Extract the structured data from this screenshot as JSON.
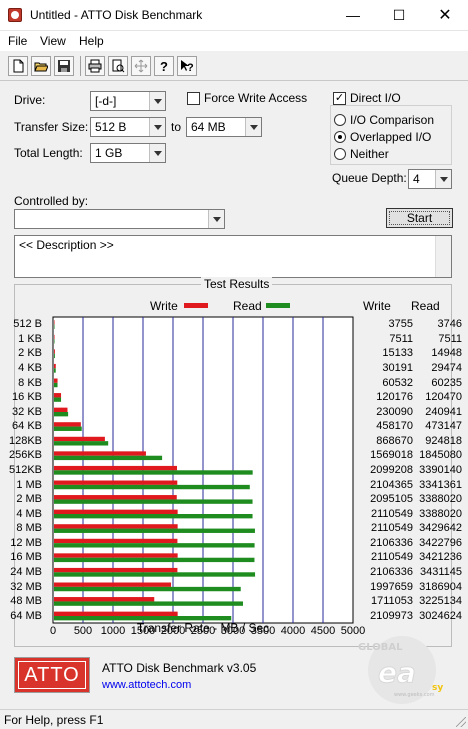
{
  "window": {
    "title": "Untitled - ATTO Disk Benchmark",
    "minimize_glyph": "—",
    "maximize_glyph": "☐",
    "close_glyph": "✕"
  },
  "menu": [
    "File",
    "View",
    "Help"
  ],
  "toolbar": {
    "icons": [
      "new-file-icon",
      "open-folder-icon",
      "save-icon",
      "print-icon",
      "print-preview-icon",
      "move-icon",
      "help-icon",
      "context-help-icon"
    ]
  },
  "settings": {
    "drive_label": "Drive:",
    "drive_value": "[-d-]",
    "transfer_size_label": "Transfer Size:",
    "transfer_size_from": "512 B",
    "to_label": "to",
    "transfer_size_to": "64 MB",
    "total_length_label": "Total Length:",
    "total_length_value": "1 GB",
    "force_write_label": "Force Write Access",
    "direct_io_label": "Direct I/O",
    "io_comparison_label": "I/O Comparison",
    "overlapped_io_label": "Overlapped I/O",
    "neither_label": "Neither",
    "queue_depth_label": "Queue Depth:",
    "queue_depth_value": "4",
    "controlled_by_label": "Controlled by:",
    "controlled_by_value": "",
    "start_label": "Start",
    "description": "<< Description >>"
  },
  "results": {
    "group_title": "Test Results",
    "legend_write": "Write",
    "legend_read": "Read",
    "col_write": "Write",
    "col_read": "Read",
    "x_axis_label": "Transfer Rate - MB / Sec",
    "rows": [
      {
        "size": "512 B",
        "write": "3755",
        "read": "3746"
      },
      {
        "size": "1 KB",
        "write": "7511",
        "read": "7511"
      },
      {
        "size": "2 KB",
        "write": "15133",
        "read": "14948"
      },
      {
        "size": "4 KB",
        "write": "30191",
        "read": "29474"
      },
      {
        "size": "8 KB",
        "write": "60532",
        "read": "60235"
      },
      {
        "size": "16 KB",
        "write": "120176",
        "read": "120470"
      },
      {
        "size": "32 KB",
        "write": "230090",
        "read": "240941"
      },
      {
        "size": "64 KB",
        "write": "458170",
        "read": "473147"
      },
      {
        "size": "128KB",
        "write": "868670",
        "read": "924818"
      },
      {
        "size": "256KB",
        "write": "1569018",
        "read": "1845080"
      },
      {
        "size": "512KB",
        "write": "2099208",
        "read": "3390140"
      },
      {
        "size": "1 MB",
        "write": "2104365",
        "read": "3341361"
      },
      {
        "size": "2 MB",
        "write": "2095105",
        "read": "3388020"
      },
      {
        "size": "4 MB",
        "write": "2110549",
        "read": "3388020"
      },
      {
        "size": "8 MB",
        "write": "2110549",
        "read": "3429642"
      },
      {
        "size": "12 MB",
        "write": "2106336",
        "read": "3422796"
      },
      {
        "size": "16 MB",
        "write": "2110549",
        "read": "3421236"
      },
      {
        "size": "24 MB",
        "write": "2106336",
        "read": "3431145"
      },
      {
        "size": "32 MB",
        "write": "1997659",
        "read": "3186904"
      },
      {
        "size": "48 MB",
        "write": "1711053",
        "read": "3225134"
      },
      {
        "size": "64 MB",
        "write": "2109973",
        "read": "3024624"
      }
    ]
  },
  "chart_data": {
    "type": "bar",
    "orientation": "horizontal",
    "title": "Test Results",
    "xlabel": "Transfer Rate - MB / Sec",
    "xlim": [
      0,
      5000
    ],
    "xticks": [
      "0",
      "500",
      "1000",
      "1500",
      "2000",
      "2500",
      "3000",
      "3500",
      "4000",
      "4500",
      "5000"
    ],
    "categories": [
      "512 B",
      "1 KB",
      "2 KB",
      "4 KB",
      "8 KB",
      "16 KB",
      "32 KB",
      "64 KB",
      "128KB",
      "256KB",
      "512KB",
      "1 MB",
      "2 MB",
      "4 MB",
      "8 MB",
      "12 MB",
      "16 MB",
      "24 MB",
      "32 MB",
      "48 MB",
      "64 MB"
    ],
    "series": [
      {
        "name": "Write",
        "color": "#e0191f",
        "values": [
          3.7,
          7.3,
          14.8,
          29.5,
          59.1,
          117.4,
          224.7,
          447.4,
          848.3,
          1532.2,
          2050,
          2055,
          2046,
          2061,
          2061,
          2057,
          2061,
          2057,
          1951,
          1671,
          2061
        ]
      },
      {
        "name": "Read",
        "color": "#1e8c1e",
        "values": [
          3.7,
          7.3,
          14.6,
          28.8,
          58.8,
          117.6,
          235.3,
          462.1,
          903.1,
          1801.8,
          3311,
          3263,
          3309,
          3309,
          3349,
          3343,
          3341,
          3351,
          3112,
          3150,
          2954
        ]
      }
    ],
    "grid": true,
    "legend": "top-center"
  },
  "footer": {
    "logo_text": "ATTO",
    "product": "ATTO Disk Benchmark v3.05",
    "url": "www.attotech.com",
    "watermark": "GLOBAL easy www.geeks.com"
  },
  "status": {
    "text": "For Help, press F1"
  }
}
